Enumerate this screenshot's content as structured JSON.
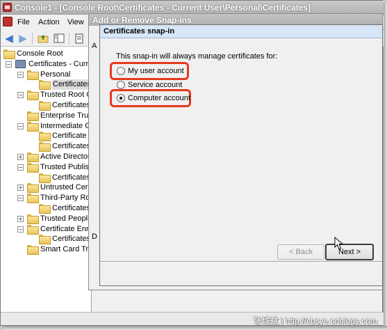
{
  "mmc": {
    "title": "Console1 - [Console Root\\Certificates - Current User\\Personal\\Certificates]",
    "menu": [
      "File",
      "Action",
      "View"
    ]
  },
  "tree": [
    {
      "label": "Console Root",
      "level": 0,
      "expander": "",
      "icon": "folder"
    },
    {
      "label": "Certificates - Curre",
      "level": 1,
      "expander": "−",
      "icon": "cert"
    },
    {
      "label": "Personal",
      "level": 2,
      "expander": "−",
      "icon": "folder"
    },
    {
      "label": "Certificates",
      "level": 3,
      "expander": "",
      "icon": "folder",
      "selected": true
    },
    {
      "label": "Trusted Root C",
      "level": 2,
      "expander": "−",
      "icon": "folder"
    },
    {
      "label": "Certificates",
      "level": 3,
      "expander": "",
      "icon": "folder"
    },
    {
      "label": "Enterprise Trus",
      "level": 2,
      "expander": "",
      "icon": "folder"
    },
    {
      "label": "Intermediate C",
      "level": 2,
      "expander": "−",
      "icon": "folder"
    },
    {
      "label": "Certificate R",
      "level": 3,
      "expander": "",
      "icon": "folder"
    },
    {
      "label": "Certificates",
      "level": 3,
      "expander": "",
      "icon": "folder"
    },
    {
      "label": "Active Directory",
      "level": 2,
      "expander": "+",
      "icon": "folder"
    },
    {
      "label": "Trusted Publish",
      "level": 2,
      "expander": "−",
      "icon": "folder"
    },
    {
      "label": "Certificates",
      "level": 3,
      "expander": "",
      "icon": "folder"
    },
    {
      "label": "Untrusted Certi",
      "level": 2,
      "expander": "+",
      "icon": "folder"
    },
    {
      "label": "Third-Party Roo",
      "level": 2,
      "expander": "−",
      "icon": "folder"
    },
    {
      "label": "Certificates",
      "level": 3,
      "expander": "",
      "icon": "folder"
    },
    {
      "label": "Trusted People",
      "level": 2,
      "expander": "+",
      "icon": "folder"
    },
    {
      "label": "Certificate Enro",
      "level": 2,
      "expander": "−",
      "icon": "folder"
    },
    {
      "label": "Certificates",
      "level": 3,
      "expander": "",
      "icon": "folder"
    },
    {
      "label": "Smart Card Tru",
      "level": 2,
      "expander": "",
      "icon": "folder"
    }
  ],
  "snapin_dialog": {
    "title": "Add or Remove Snap-ins"
  },
  "wizard": {
    "title": "Certificates snap-in",
    "prompt": "This snap-in will always manage certificates for:",
    "options": [
      {
        "label": "My user account",
        "checked": false,
        "highlighted": true
      },
      {
        "label": "Service account",
        "checked": false,
        "highlighted": false
      },
      {
        "label": "Computer account",
        "checked": true,
        "highlighted": true
      }
    ],
    "back_label": "< Back",
    "next_label": "Next >"
  },
  "watermark": "张城斌 | http://cbcye.cnblogs.com",
  "colors": {
    "highlight": "#e8381f",
    "folder": "#f2d27a"
  }
}
